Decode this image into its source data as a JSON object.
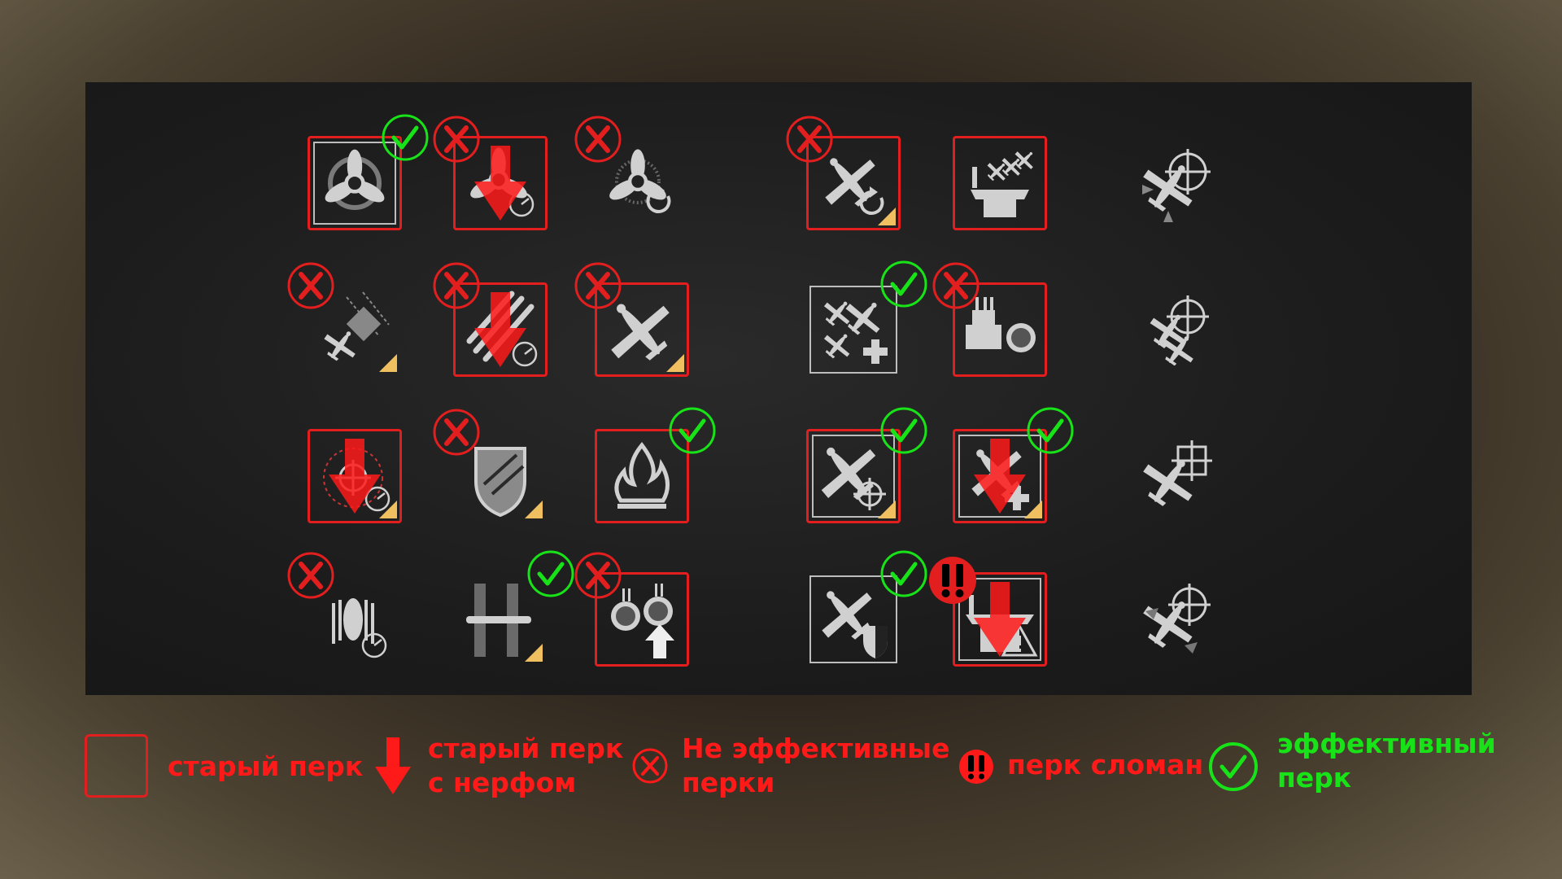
{
  "legend": {
    "old_perk": "старый перк",
    "nerfed_line1": "старый перк",
    "nerfed_line2": "с нерфом",
    "ineffective_line1": "Не эффективные",
    "ineffective_line2": "перки",
    "broken": "перк сломан",
    "effective_line1": "эффективный",
    "effective_line2": "перк"
  },
  "colors": {
    "red": "#e31e1e",
    "green": "#18e318",
    "yellow": "#f0c060",
    "icon_gray": "#d0d0d0"
  },
  "perks": [
    {
      "row": 1,
      "col": 1,
      "icon": "propeller-cycle-icon",
      "framed": true,
      "inner_frame": true,
      "nerf": false,
      "status": "effective"
    },
    {
      "row": 1,
      "col": 2,
      "icon": "propeller-timer-icon",
      "framed": true,
      "inner_frame": false,
      "nerf": true,
      "status": "ineffective"
    },
    {
      "row": 1,
      "col": 3,
      "icon": "propeller-reload-icon",
      "framed": false,
      "inner_frame": false,
      "nerf": false,
      "status": "ineffective"
    },
    {
      "row": 1,
      "col": 4,
      "icon": "plane-reload-icon",
      "framed": true,
      "inner_frame": false,
      "nerf": false,
      "status": "ineffective",
      "triangle": true
    },
    {
      "row": 1,
      "col": 5,
      "icon": "carrier-planes-icon",
      "framed": true,
      "inner_frame": false,
      "nerf": false,
      "status": "none"
    },
    {
      "row": 1,
      "col": 6,
      "icon": "plane-crosshair-icon",
      "framed": false,
      "inner_frame": false,
      "nerf": false,
      "status": "none"
    },
    {
      "row": 2,
      "col": 1,
      "icon": "plane-drop-icon",
      "framed": false,
      "inner_frame": false,
      "nerf": false,
      "status": "ineffective",
      "triangle": true
    },
    {
      "row": 2,
      "col": 2,
      "icon": "rockets-speed-icon",
      "framed": true,
      "inner_frame": false,
      "nerf": true,
      "status": "ineffective"
    },
    {
      "row": 2,
      "col": 3,
      "icon": "attack-plane-icon",
      "framed": true,
      "inner_frame": false,
      "nerf": false,
      "status": "ineffective",
      "triangle": true
    },
    {
      "row": 2,
      "col": 4,
      "icon": "squadron-plus-icon",
      "framed": false,
      "inner_frame": true,
      "nerf": false,
      "status": "effective"
    },
    {
      "row": 2,
      "col": 5,
      "icon": "aa-guns-icon",
      "framed": true,
      "inner_frame": false,
      "nerf": false,
      "status": "ineffective"
    },
    {
      "row": 2,
      "col": 6,
      "icon": "planes-crosshair-icon",
      "framed": false,
      "inner_frame": false,
      "nerf": false,
      "status": "none"
    },
    {
      "row": 3,
      "col": 1,
      "icon": "target-timer-icon",
      "framed": true,
      "inner_frame": false,
      "nerf": true,
      "status": "none",
      "triangle": true
    },
    {
      "row": 3,
      "col": 2,
      "icon": "shield-rockets-icon",
      "framed": false,
      "inner_frame": false,
      "nerf": false,
      "status": "ineffective",
      "triangle": true
    },
    {
      "row": 3,
      "col": 3,
      "icon": "fire-icon",
      "framed": true,
      "inner_frame": false,
      "nerf": false,
      "status": "effective"
    },
    {
      "row": 3,
      "col": 4,
      "icon": "plane-target-icon",
      "framed": true,
      "inner_frame": true,
      "nerf": false,
      "status": "effective",
      "triangle": true
    },
    {
      "row": 3,
      "col": 5,
      "icon": "plane-heal-icon",
      "framed": true,
      "inner_frame": true,
      "nerf": true,
      "status": "effective",
      "triangle": true
    },
    {
      "row": 3,
      "col": 6,
      "icon": "plane-square-sight-icon",
      "framed": false,
      "inner_frame": false,
      "nerf": false,
      "status": "none"
    },
    {
      "row": 4,
      "col": 1,
      "icon": "bomb-speed-icon",
      "framed": false,
      "inner_frame": false,
      "nerf": false,
      "status": "ineffective"
    },
    {
      "row": 4,
      "col": 2,
      "icon": "torpedo-icon",
      "framed": false,
      "inner_frame": false,
      "nerf": false,
      "status": "effective",
      "triangle": true
    },
    {
      "row": 4,
      "col": 3,
      "icon": "aa-upgrade-icon",
      "framed": true,
      "inner_frame": false,
      "nerf": false,
      "status": "ineffective"
    },
    {
      "row": 4,
      "col": 4,
      "icon": "plane-shield-icon",
      "framed": false,
      "inner_frame": true,
      "nerf": false,
      "status": "effective"
    },
    {
      "row": 4,
      "col": 5,
      "icon": "carrier-warning-icon",
      "framed": true,
      "inner_frame": true,
      "nerf": true,
      "status": "broken"
    },
    {
      "row": 4,
      "col": 6,
      "icon": "plane-boost-crosshair-icon",
      "framed": false,
      "inner_frame": false,
      "nerf": false,
      "status": "none"
    }
  ]
}
